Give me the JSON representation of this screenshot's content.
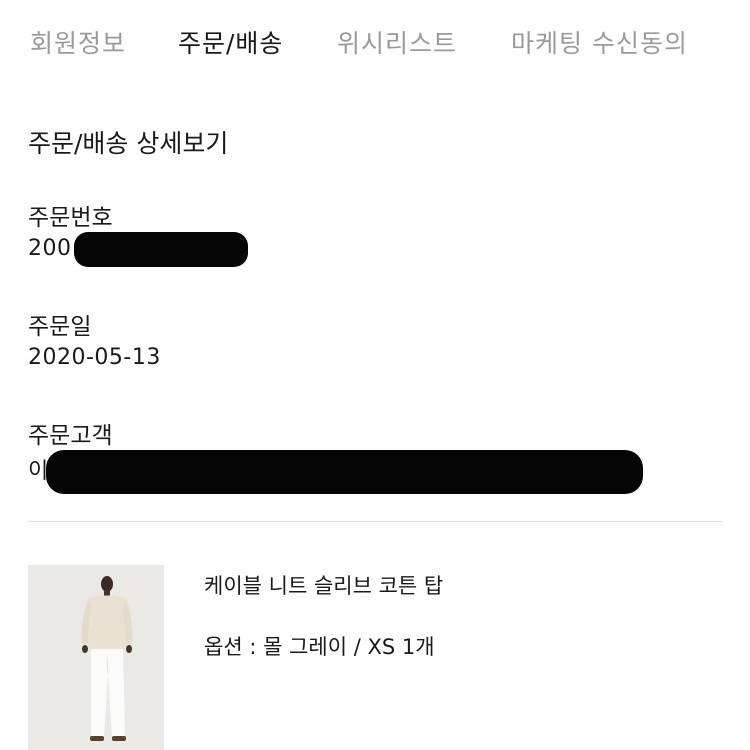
{
  "tabs": [
    {
      "label": "회원정보",
      "active": false
    },
    {
      "label": "주문/배송",
      "active": true
    },
    {
      "label": "위시리스트",
      "active": false
    },
    {
      "label": "마케팅 수신동의",
      "active": false
    }
  ],
  "detail": {
    "title": "주문/배송 상세보기",
    "order_number": {
      "label": "주문번호",
      "value": "200"
    },
    "order_date": {
      "label": "주문일",
      "value": "2020-05-13"
    },
    "customer": {
      "label": "주문고객",
      "value": "이"
    }
  },
  "product": {
    "name": "케이블 니트 슬리브 코튼 탑",
    "option": "옵션 : 몰 그레이 / XS 1개"
  }
}
